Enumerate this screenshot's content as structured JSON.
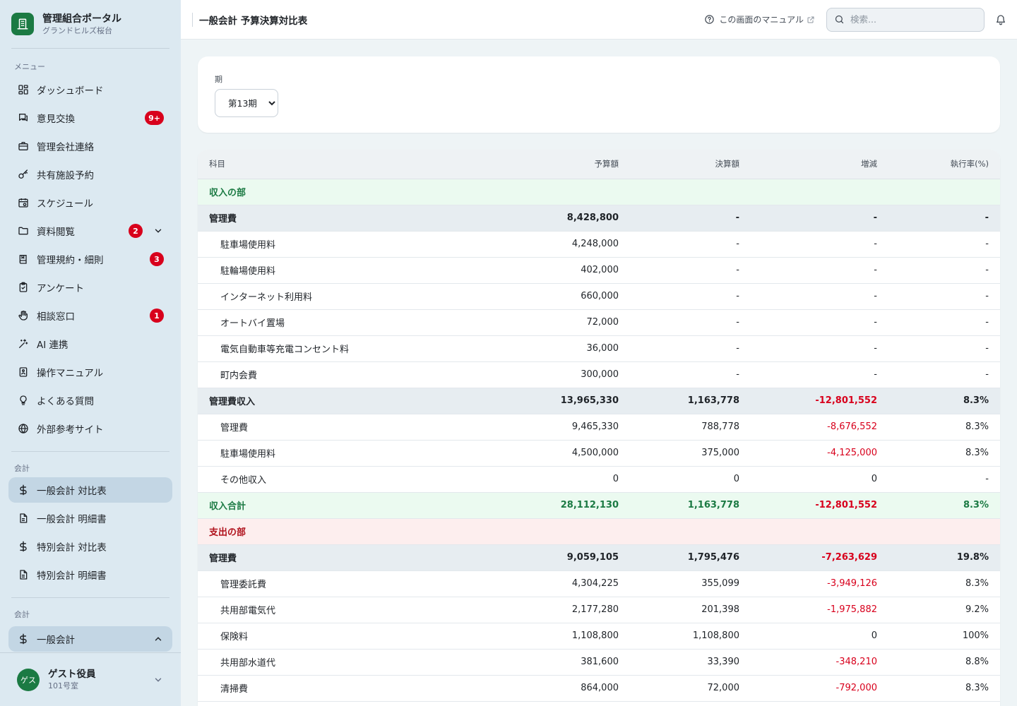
{
  "app": {
    "title": "管理組合ポータル",
    "subtitle": "グランドヒルズ桜台"
  },
  "sidebar": {
    "menu_label": "メニュー",
    "menu_items": [
      {
        "label": "ダッシュボード",
        "icon": "dashboard-icon"
      },
      {
        "label": "意見交換",
        "icon": "chat-icon",
        "badge": "9+"
      },
      {
        "label": "管理会社連絡",
        "icon": "briefcase-icon"
      },
      {
        "label": "共有施設予約",
        "icon": "key-icon"
      },
      {
        "label": "スケジュール",
        "icon": "calendar-icon"
      },
      {
        "label": "資料閲覧",
        "icon": "folder-icon",
        "badge": "2"
      },
      {
        "label": "管理規約・細則",
        "icon": "book-icon",
        "badge": "3"
      },
      {
        "label": "アンケート",
        "icon": "clipboard-icon"
      },
      {
        "label": "相談窓口",
        "icon": "hand-icon",
        "badge": "1"
      },
      {
        "label": "AI 連携",
        "icon": "sparkle-icon"
      },
      {
        "label": "操作マニュアル",
        "icon": "manual-icon"
      },
      {
        "label": "よくある質問",
        "icon": "lightbulb-icon"
      },
      {
        "label": "外部参考サイト",
        "icon": "globe-icon"
      }
    ],
    "accounting_label": "会計",
    "accounting_items": [
      {
        "label": "一般会計 対比表",
        "icon": "dollar-icon",
        "active": true
      },
      {
        "label": "一般会計 明細書",
        "icon": "document-icon"
      },
      {
        "label": "特別会計 対比表",
        "icon": "dollar-icon"
      },
      {
        "label": "特別会計 明細書",
        "icon": "document-icon"
      }
    ],
    "accounting_label_2": "会計",
    "accounting_group": {
      "label": "一般会計",
      "icon": "dollar-icon"
    }
  },
  "user": {
    "avatar": "ゲス",
    "name": "ゲスト役員",
    "room": "101号室"
  },
  "topbar": {
    "title": "一般会計 予算決算対比表",
    "manual_link": "この画面のマニュアル",
    "search_placeholder": "検索..."
  },
  "filter": {
    "label": "期",
    "selected": "第13期"
  },
  "table": {
    "headers": [
      "科目",
      "予算額",
      "決算額",
      "増減",
      "執行率(%)"
    ],
    "rows": [
      {
        "type": "income-section",
        "name": "収入の部",
        "budget": "",
        "actual": "",
        "diff": "",
        "rate": ""
      },
      {
        "type": "group",
        "name": "管理費",
        "budget": "8,428,800",
        "actual": "-",
        "diff": "-",
        "rate": "-"
      },
      {
        "type": "item",
        "name": "駐車場使用料",
        "budget": "4,248,000",
        "actual": "-",
        "diff": "-",
        "rate": "-"
      },
      {
        "type": "item",
        "name": "駐輪場使用料",
        "budget": "402,000",
        "actual": "-",
        "diff": "-",
        "rate": "-"
      },
      {
        "type": "item",
        "name": "インターネット利用料",
        "budget": "660,000",
        "actual": "-",
        "diff": "-",
        "rate": "-"
      },
      {
        "type": "item",
        "name": "オートバイ置場",
        "budget": "72,000",
        "actual": "-",
        "diff": "-",
        "rate": "-"
      },
      {
        "type": "item",
        "name": "電気自動車等充電コンセント料",
        "budget": "36,000",
        "actual": "-",
        "diff": "-",
        "rate": "-"
      },
      {
        "type": "item",
        "name": "町内会費",
        "budget": "300,000",
        "actual": "-",
        "diff": "-",
        "rate": "-"
      },
      {
        "type": "group",
        "name": "管理費収入",
        "budget": "13,965,330",
        "actual": "1,163,778",
        "diff": "-12,801,552",
        "rate": "8.3%"
      },
      {
        "type": "item",
        "name": "管理費",
        "budget": "9,465,330",
        "actual": "788,778",
        "diff": "-8,676,552",
        "rate": "8.3%"
      },
      {
        "type": "item",
        "name": "駐車場使用料",
        "budget": "4,500,000",
        "actual": "375,000",
        "diff": "-4,125,000",
        "rate": "8.3%"
      },
      {
        "type": "item",
        "name": "その他収入",
        "budget": "0",
        "actual": "0",
        "diff": "0",
        "rate": "-"
      },
      {
        "type": "income-total",
        "name": "収入合計",
        "budget": "28,112,130",
        "actual": "1,163,778",
        "diff": "-12,801,552",
        "rate": "8.3%"
      },
      {
        "type": "expense-section",
        "name": "支出の部",
        "budget": "",
        "actual": "",
        "diff": "",
        "rate": ""
      },
      {
        "type": "group",
        "name": "管理費",
        "budget": "9,059,105",
        "actual": "1,795,476",
        "diff": "-7,263,629",
        "rate": "19.8%"
      },
      {
        "type": "item",
        "name": "管理委託費",
        "budget": "4,304,225",
        "actual": "355,099",
        "diff": "-3,949,126",
        "rate": "8.3%"
      },
      {
        "type": "item",
        "name": "共用部電気代",
        "budget": "2,177,280",
        "actual": "201,398",
        "diff": "-1,975,882",
        "rate": "9.2%"
      },
      {
        "type": "item",
        "name": "保険料",
        "budget": "1,108,800",
        "actual": "1,108,800",
        "diff": "0",
        "rate": "100%"
      },
      {
        "type": "item",
        "name": "共用部水道代",
        "budget": "381,600",
        "actual": "33,390",
        "diff": "-348,210",
        "rate": "8.8%"
      },
      {
        "type": "item",
        "name": "清掃費",
        "budget": "864,000",
        "actual": "72,000",
        "diff": "-792,000",
        "rate": "8.3%"
      }
    ]
  },
  "colors": {
    "brand": "#1b7a43",
    "badge": "#d8001c",
    "negative": "#d8001c",
    "income": "#1b7a43",
    "expense": "#b0121c",
    "sidebar_bg": "#dce9f1"
  }
}
